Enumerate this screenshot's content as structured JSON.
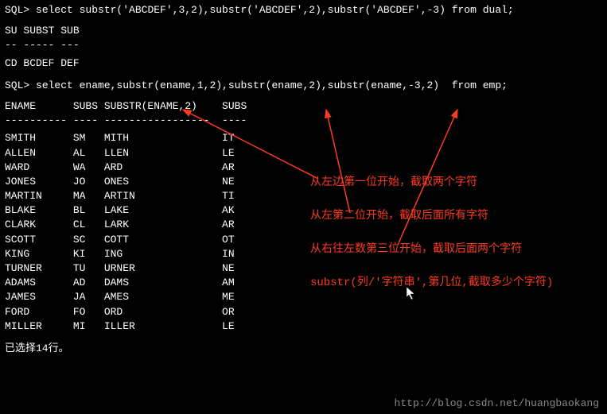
{
  "sql1": {
    "prompt": "SQL>",
    "query": " select substr('ABCDEF',3,2),substr('ABCDEF',2),substr('ABCDEF',-3) from dual;",
    "header": "SU SUBST SUB",
    "separator": "-- ----- ---",
    "result": "CD BCDEF DEF"
  },
  "sql2": {
    "prompt": "SQL>",
    "query": " select ename,substr(ename,1,2),substr(ename,2),substr(ename,-3,2)  from emp;",
    "columns": [
      "ENAME",
      "SUBS",
      "SUBSTR(ENAME,2)",
      "SUBS"
    ],
    "separator": [
      "----------",
      "----",
      "-----------------",
      "----"
    ],
    "rows": [
      [
        "SMITH",
        "SM",
        "MITH",
        "IT"
      ],
      [
        "ALLEN",
        "AL",
        "LLEN",
        "LE"
      ],
      [
        "WARD",
        "WA",
        "ARD",
        "AR"
      ],
      [
        "JONES",
        "JO",
        "ONES",
        "NE"
      ],
      [
        "MARTIN",
        "MA",
        "ARTIN",
        "TI"
      ],
      [
        "BLAKE",
        "BL",
        "LAKE",
        "AK"
      ],
      [
        "CLARK",
        "CL",
        "LARK",
        "AR"
      ],
      [
        "SCOTT",
        "SC",
        "COTT",
        "OT"
      ],
      [
        "KING",
        "KI",
        "ING",
        "IN"
      ],
      [
        "TURNER",
        "TU",
        "URNER",
        "NE"
      ],
      [
        "ADAMS",
        "AD",
        "DAMS",
        "AM"
      ],
      [
        "JAMES",
        "JA",
        "AMES",
        "ME"
      ],
      [
        "FORD",
        "FO",
        "ORD",
        "OR"
      ],
      [
        "MILLER",
        "MI",
        "ILLER",
        "LE"
      ]
    ]
  },
  "summary": "已选择14行。",
  "watermark": "http://blog.csdn.net/huangbaokang",
  "annotations": {
    "line1": "从左边第一位开始，截取两个字符",
    "line2": "从左第二位开始，截取后面所有字符",
    "line3": "从右往左数第三位开始，截取后面两个字符",
    "line4": "substr(列/'字符串',第几位,截取多少个字符)"
  }
}
